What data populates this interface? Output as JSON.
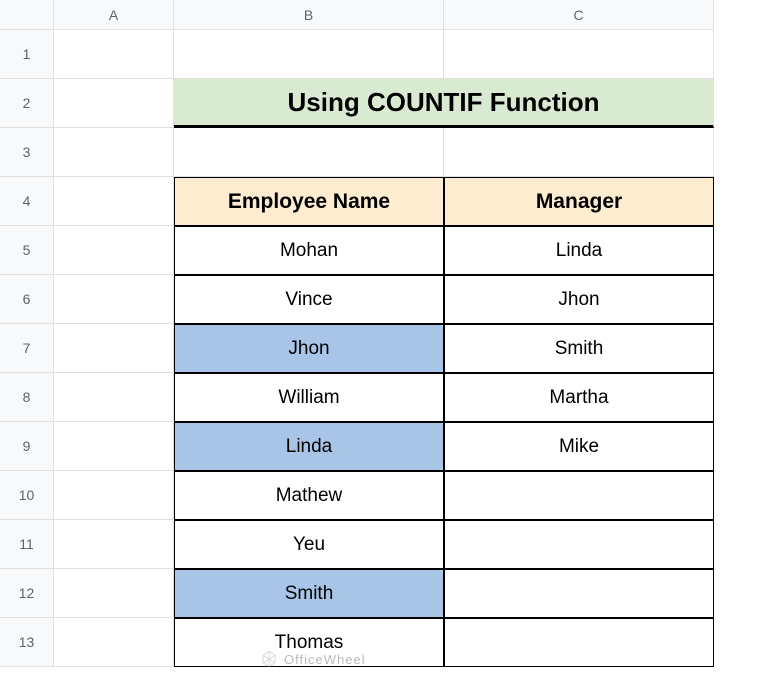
{
  "columns": [
    "A",
    "B",
    "C"
  ],
  "rows": [
    "1",
    "2",
    "3",
    "4",
    "5",
    "6",
    "7",
    "8",
    "9",
    "10",
    "11",
    "12",
    "13"
  ],
  "title": "Using COUNTIF Function",
  "table": {
    "headers": {
      "b": "Employee Name",
      "c": "Manager"
    },
    "data": [
      {
        "employee": "Mohan",
        "manager": "Linda",
        "highlighted": false
      },
      {
        "employee": "Vince",
        "manager": "Jhon",
        "highlighted": false
      },
      {
        "employee": "Jhon",
        "manager": "Smith",
        "highlighted": true
      },
      {
        "employee": "William",
        "manager": "Martha",
        "highlighted": false
      },
      {
        "employee": "Linda",
        "manager": "Mike",
        "highlighted": true
      },
      {
        "employee": "Mathew",
        "manager": "",
        "highlighted": false
      },
      {
        "employee": "Yeu",
        "manager": "",
        "highlighted": false
      },
      {
        "employee": "Smith",
        "manager": "",
        "highlighted": true
      },
      {
        "employee": "Thomas",
        "manager": "",
        "highlighted": false
      }
    ]
  },
  "watermark": "OfficeWheel"
}
